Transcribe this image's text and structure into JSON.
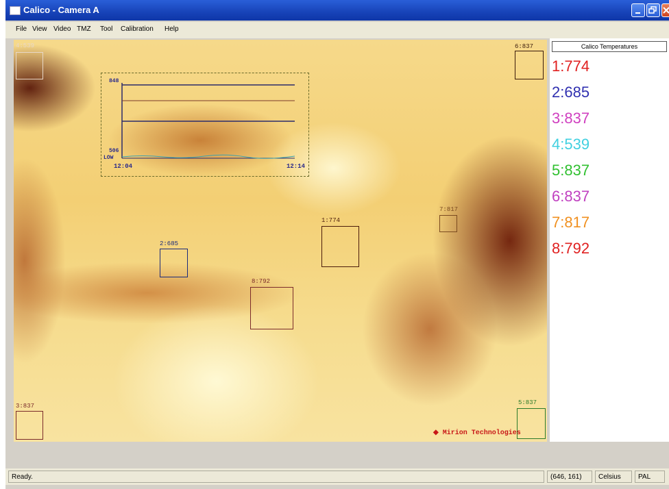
{
  "window": {
    "title": "Calico - Camera A"
  },
  "menu": [
    "File",
    "View",
    "Video",
    "TMZ",
    "Tool",
    "Calibration",
    "Help"
  ],
  "image_overlay": {
    "rois": [
      {
        "label": "4:539",
        "color": "#e8d8c8"
      },
      {
        "label": "6:837",
        "color": "#3a1a0a"
      },
      {
        "label": "1:774",
        "color": "#4a1a0a"
      },
      {
        "label": "7:817",
        "color": "#7a4a20"
      },
      {
        "label": "2:685",
        "color": "#1a2a7a"
      },
      {
        "label": "8:792",
        "color": "#7a2a2a"
      },
      {
        "label": "3:837",
        "color": "#7a2a2a"
      },
      {
        "label": "5:837",
        "color": "#2a7a2a"
      }
    ],
    "trend": {
      "y_high": "848",
      "y_low": "506",
      "low_tag": "LOW",
      "x_start": "12:04",
      "x_end": "12:14"
    },
    "brand": "Mirion Technologies"
  },
  "panel": {
    "title": "Calico Temperatures",
    "temps": [
      {
        "text": "1:774",
        "color": "#e02020"
      },
      {
        "text": "2:685",
        "color": "#3030b0"
      },
      {
        "text": "3:837",
        "color": "#d040c0"
      },
      {
        "text": "4:539",
        "color": "#40d0e0"
      },
      {
        "text": "5:837",
        "color": "#30c030"
      },
      {
        "text": "6:837",
        "color": "#c040c0"
      },
      {
        "text": "7:817",
        "color": "#f09020"
      },
      {
        "text": "8:792",
        "color": "#e02020"
      }
    ]
  },
  "status": {
    "ready": "Ready.",
    "coords": "(646, 161)",
    "units": "Celsius",
    "format": "PAL"
  }
}
